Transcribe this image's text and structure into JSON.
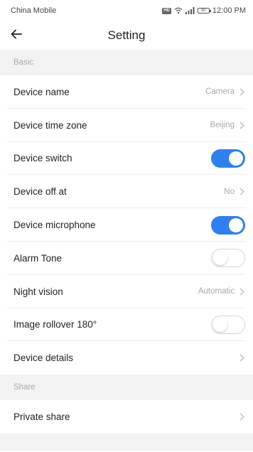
{
  "status_bar": {
    "carrier": "China Mobile",
    "battery": "80",
    "time": "12:00 PM"
  },
  "header": {
    "title": "Setting"
  },
  "sections": {
    "basic": {
      "title": "Basic"
    },
    "share": {
      "title": "Share"
    }
  },
  "rows": {
    "device_name": {
      "label": "Device name",
      "value": "Camera"
    },
    "device_time_zone": {
      "label": "Device time zone",
      "value": "Beijing"
    },
    "device_switch": {
      "label": "Device switch",
      "on": true
    },
    "device_off_at": {
      "label": "Device off at",
      "value": "No"
    },
    "device_microphone": {
      "label": "Device microphone",
      "on": true
    },
    "alarm_tone": {
      "label": "Alarm Tone",
      "on": false
    },
    "night_vision": {
      "label": "Night vision",
      "value": "Automatic"
    },
    "image_rollover": {
      "label": "Image rollover 180°",
      "on": false
    },
    "device_details": {
      "label": "Device details"
    },
    "private_share": {
      "label": "Private share"
    }
  },
  "colors": {
    "accent": "#2f80ed",
    "section_bg": "#f3f3f3",
    "muted_text": "#a8a8a8"
  },
  "icons": {
    "back": "arrow-left-icon",
    "chevron": "chevron-right-icon"
  }
}
